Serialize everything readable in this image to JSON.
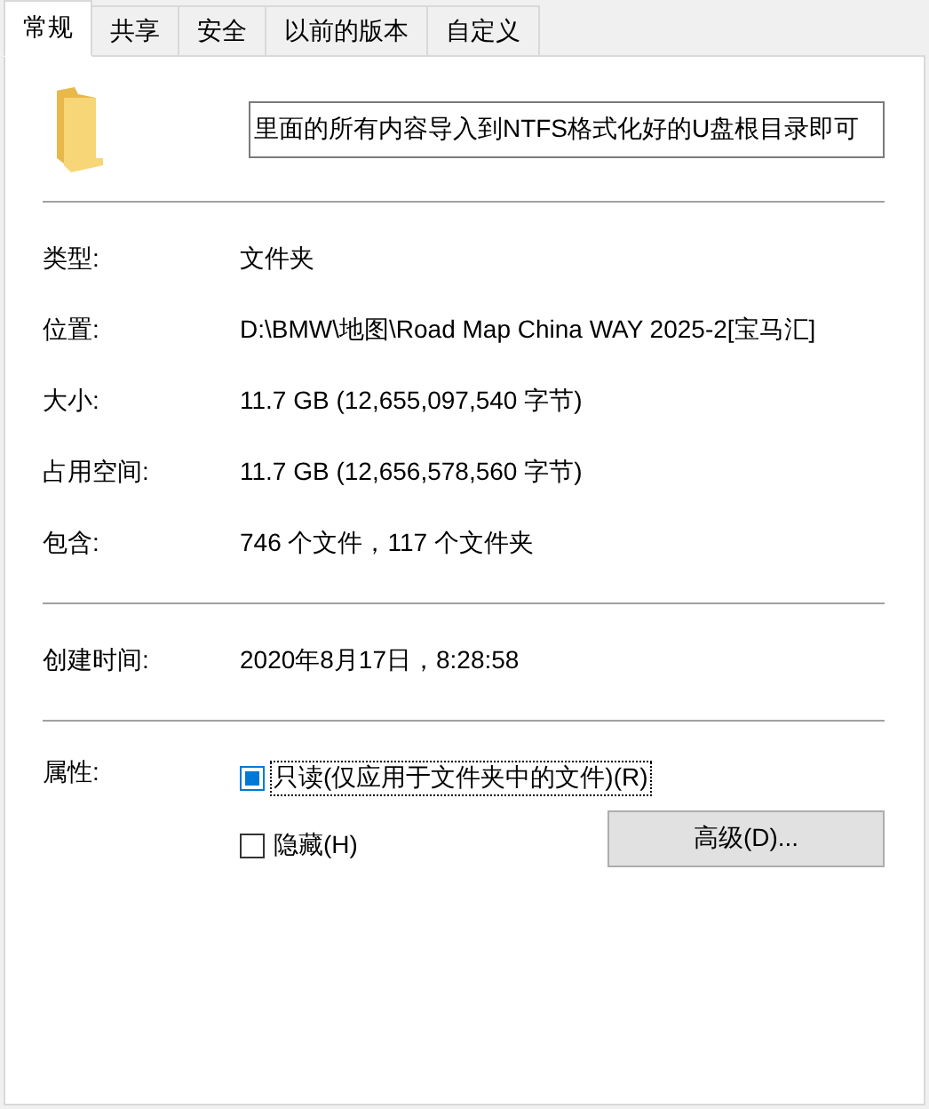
{
  "tabs": [
    {
      "label": "常规",
      "selected": true
    },
    {
      "label": "共享",
      "selected": false
    },
    {
      "label": "安全",
      "selected": false
    },
    {
      "label": "以前的版本",
      "selected": false
    },
    {
      "label": "自定义",
      "selected": false
    }
  ],
  "name_field": {
    "value": "里面的所有内容导入到NTFS格式化好的U盘根目录即可"
  },
  "details": [
    {
      "label": "类型:",
      "value": "文件夹"
    },
    {
      "label": "位置:",
      "value": "D:\\BMW\\地图\\Road Map China WAY 2025-2[宝马汇]"
    },
    {
      "label": "大小:",
      "value": "11.7 GB (12,655,097,540 字节)"
    },
    {
      "label": "占用空间:",
      "value": "11.7 GB (12,656,578,560 字节)"
    },
    {
      "label": "包含:",
      "value": "746 个文件，117 个文件夹"
    }
  ],
  "created": {
    "label": "创建时间:",
    "value": "2020年8月17日，8:28:58"
  },
  "attributes": {
    "label": "属性:",
    "items": [
      {
        "label": "只读(仅应用于文件夹中的文件)(R)",
        "checked": false,
        "indeterminate": true,
        "focused": true
      },
      {
        "label": "隐藏(H)",
        "checked": false,
        "indeterminate": false,
        "focused": false
      }
    ],
    "button": "高级(D)..."
  }
}
